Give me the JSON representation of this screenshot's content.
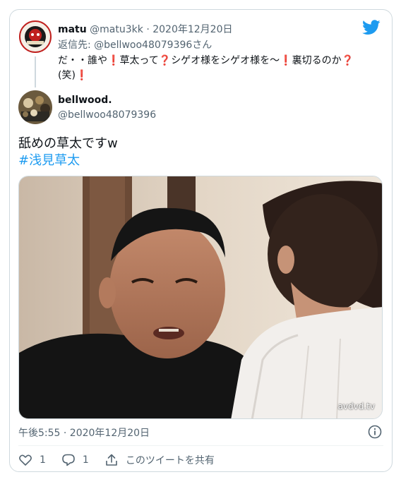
{
  "parent": {
    "name": "matu",
    "handle": "@matu3kk",
    "separator": "·",
    "date": "2020年12月20日",
    "reply_label": "返信先:",
    "reply_handle": "@bellwoo48079396",
    "reply_suffix": "さん",
    "text_part1": "だ・・誰や",
    "text_part2": "草太って",
    "text_part3": "シゲオ様をシゲオ様を〜",
    "text_part4": "裏切るのか",
    "text_part5": "(笑)",
    "excl": "❗",
    "q": "❓"
  },
  "tweet": {
    "name": "bellwood.",
    "handle": "@bellwoo48079396",
    "text": "舐めの草太ですw",
    "hashtag": "#浅見草太",
    "media_watermark": "avdvd.tv",
    "timestamp": "午後5:55 · 2020年12月20日"
  },
  "actions": {
    "like_count": "1",
    "reply_count": "1",
    "share_label": "このツイートを共有"
  },
  "colors": {
    "brand": "#1d9bf0",
    "text": "#0f1419",
    "muted": "#536471",
    "border": "#cfd9de",
    "accent_red": "#e0245e"
  },
  "icons": [
    "twitter-bird-icon",
    "info-icon",
    "heart-icon",
    "reply-bubble-icon",
    "share-icon"
  ]
}
